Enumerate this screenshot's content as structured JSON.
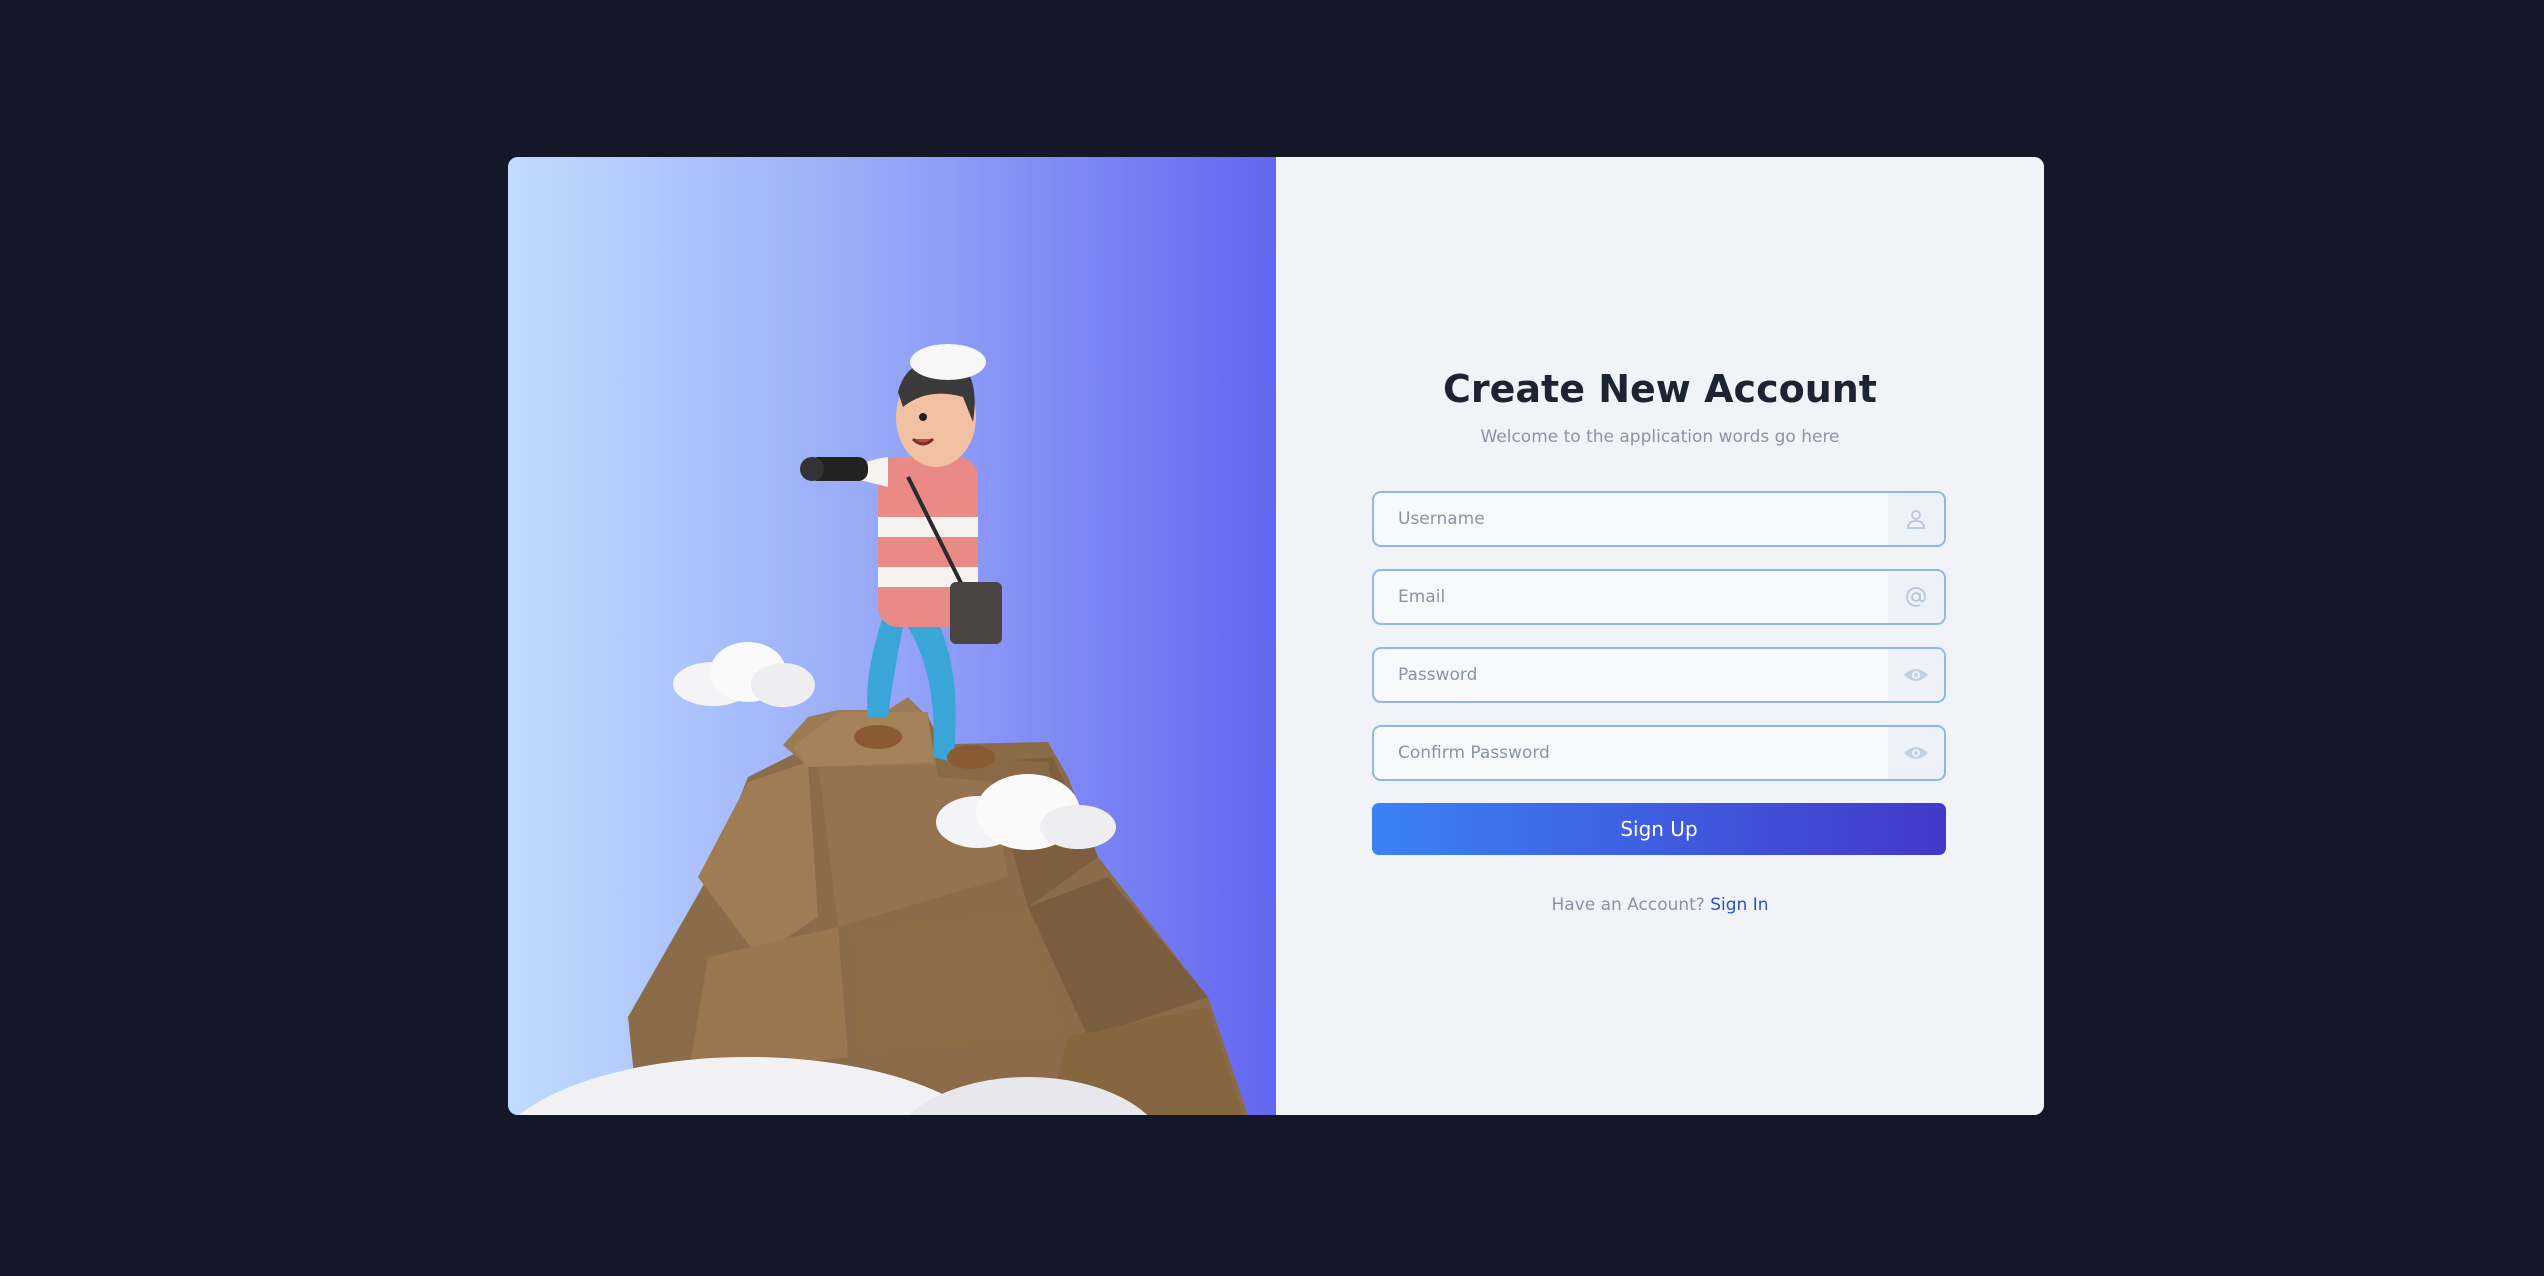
{
  "form": {
    "title": "Create New Account",
    "subtitle": "Welcome to the application words go here",
    "fields": {
      "username": {
        "placeholder": "Username",
        "icon": "user-icon"
      },
      "email": {
        "placeholder": "Email",
        "icon": "at-icon"
      },
      "password": {
        "placeholder": "Password",
        "icon": "eye-icon"
      },
      "confirm_password": {
        "placeholder": "Confirm Password",
        "icon": "eye-icon"
      }
    },
    "submit_label": "Sign Up",
    "footer_text": "Have an Account?",
    "footer_link": "Sign In"
  },
  "colors": {
    "background": "#121827",
    "panel": "#f0f3f8",
    "accent_start": "#3b82f6",
    "accent_end": "#4338ca",
    "field_border": "#8fb7ef",
    "link": "#2f4fc4"
  }
}
